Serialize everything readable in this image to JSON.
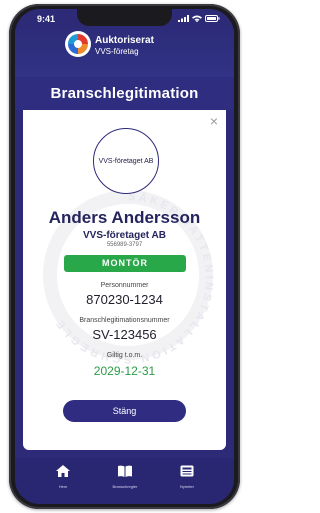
{
  "status_bar": {
    "time": "9:41"
  },
  "header": {
    "brand_line1": "Auktoriserat",
    "brand_line2": "VVS-företag"
  },
  "card": {
    "title": "Branschlegitimation",
    "close_symbol": "×",
    "photo_text": "VVS-företaget AB",
    "name": "Anders Andersson",
    "company": "VVS-företaget AB",
    "org_number": "556989-3797",
    "role_badge": "MONTÖR",
    "personnummer_label": "Personnummer",
    "personnummer_value": "870230-1234",
    "legitimation_label": "Branschlegitimationsnummer",
    "legitimation_value": "SV-123456",
    "valid_label": "Giltig t.o.m.",
    "valid_value": "2029-12-31",
    "close_button": "Stäng",
    "watermark_text": "SÄKER VATTENINSTALLATION SCHREGLE"
  },
  "tabs": [
    {
      "label": "Hem",
      "icon": "home-icon"
    },
    {
      "label": "Branschregler",
      "icon": "book-icon"
    },
    {
      "label": "Nyheter",
      "icon": "news-icon"
    }
  ],
  "colors": {
    "primary": "#2d2a78",
    "badge_green": "#29a84a",
    "date_green": "#2a9c45"
  }
}
